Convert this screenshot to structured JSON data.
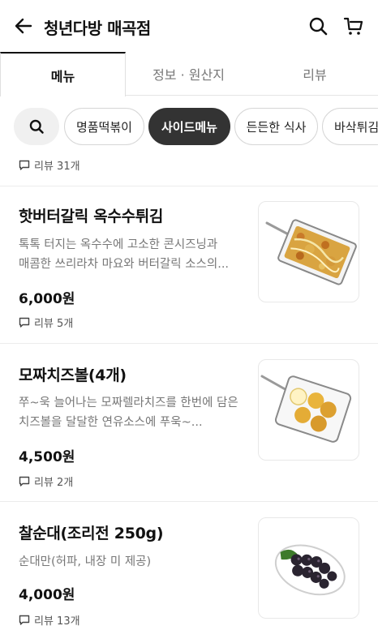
{
  "header": {
    "title": "청년다방 매곡점",
    "back_icon": "arrow-left-icon",
    "search_icon": "search-icon",
    "cart_icon": "cart-icon"
  },
  "tabs": [
    {
      "label": "메뉴",
      "active": true
    },
    {
      "label": "정보 · 원산지",
      "active": false
    },
    {
      "label": "리뷰",
      "active": false
    }
  ],
  "categories": [
    {
      "label": "명품떡볶이",
      "active": false
    },
    {
      "label": "사이드메뉴",
      "active": true
    },
    {
      "label": "든든한 식사",
      "active": false
    },
    {
      "label": "바삭튀김",
      "active": false
    }
  ],
  "previous_item": {
    "review_text": "리뷰 31개"
  },
  "items": [
    {
      "name": "핫버터갈릭 옥수수튀김",
      "desc_line1": "톡톡 터지는 옥수수에 고소한 콘시즈닝과",
      "desc_line2": "매콤한 쓰리라차 마요와 버터갈릭 소스의...",
      "price": "6,000원",
      "review_text": "리뷰 5개"
    },
    {
      "name": "모짜치즈볼(4개)",
      "desc_line1": "쭈~욱 늘어나는 모짜렐라치즈를 한번에 담은",
      "desc_line2": "치즈볼을 달달한 연유소스에 푸욱~...",
      "price": "4,500원",
      "review_text": "리뷰 2개"
    },
    {
      "name": "찰순대(조리전 250g)",
      "desc_line1": "순대만(허파, 내장 미 제공)",
      "desc_line2": "",
      "price": "4,000원",
      "review_text": "리뷰 13개"
    }
  ],
  "colors": {
    "active_chip": "#333333",
    "text_primary": "#111111",
    "text_secondary": "#777777"
  }
}
